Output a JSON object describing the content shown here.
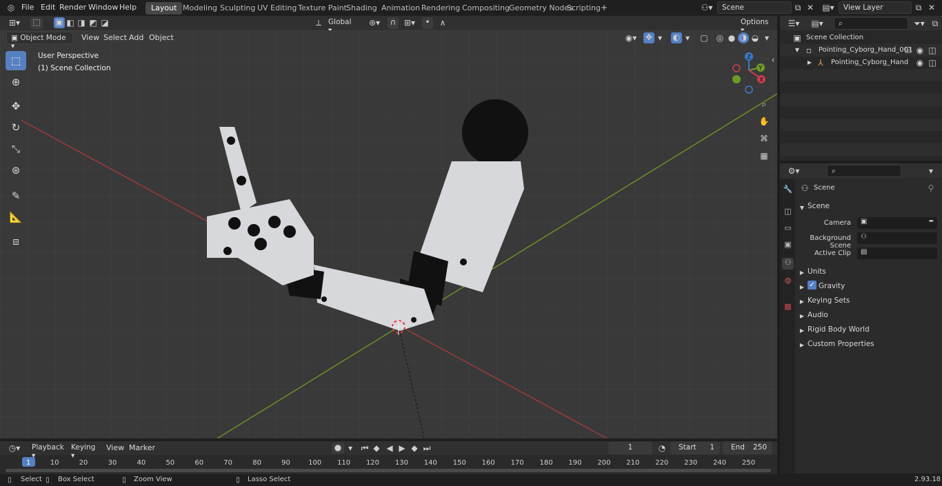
{
  "menu": {
    "items": [
      "File",
      "Edit",
      "Render",
      "Window",
      "Help"
    ]
  },
  "workspaces": {
    "tabs": [
      "Layout",
      "Modeling",
      "Sculpting",
      "UV Editing",
      "Texture Paint",
      "Shading",
      "Animation",
      "Rendering",
      "Compositing",
      "Geometry Nodes",
      "Scripting"
    ],
    "active": "Layout",
    "add_label": "+"
  },
  "scene_selector": {
    "value": "Scene"
  },
  "view_layer_selector": {
    "value": "View Layer"
  },
  "viewport_header": {
    "mode": "Object Mode",
    "menus": [
      "View",
      "Select",
      "Add",
      "Object"
    ],
    "transform_orientation": "Global",
    "options_label": "Options"
  },
  "viewport": {
    "perspective_label": "User Perspective",
    "collection_label": "(1) Scene Collection",
    "gizmo_axes": [
      "Z",
      "Y",
      "X"
    ]
  },
  "outliner": {
    "root": "Scene Collection",
    "items": [
      {
        "name": "Pointing_Cyborg_Hand_001",
        "icon": "collection-icon"
      },
      {
        "name": "Pointing_Cyborg_Hand",
        "icon": "armature-icon"
      }
    ]
  },
  "properties": {
    "breadcrumb": "Scene",
    "section": "Scene",
    "fields": [
      {
        "label": "Camera",
        "value": ""
      },
      {
        "label": "Background Scene",
        "value": ""
      },
      {
        "label": "Active Clip",
        "value": ""
      }
    ],
    "panels": [
      "Units",
      "Gravity",
      "Keying Sets",
      "Audio",
      "Rigid Body World",
      "Custom Properties"
    ],
    "gravity_checked": true
  },
  "timeline": {
    "menus": [
      "Playback",
      "Keying",
      "View",
      "Marker"
    ],
    "current_frame": "1",
    "start_label": "Start",
    "start_value": "1",
    "end_label": "End",
    "end_value": "250",
    "ticks": [
      "1",
      "10",
      "20",
      "30",
      "40",
      "50",
      "60",
      "70",
      "80",
      "90",
      "100",
      "110",
      "120",
      "130",
      "140",
      "150",
      "160",
      "170",
      "180",
      "190",
      "200",
      "210",
      "220",
      "230",
      "240",
      "250"
    ]
  },
  "statusbar": {
    "items": [
      "Select",
      "Box Select",
      "Zoom View",
      "Lasso Select"
    ],
    "version": "2.93.18"
  }
}
